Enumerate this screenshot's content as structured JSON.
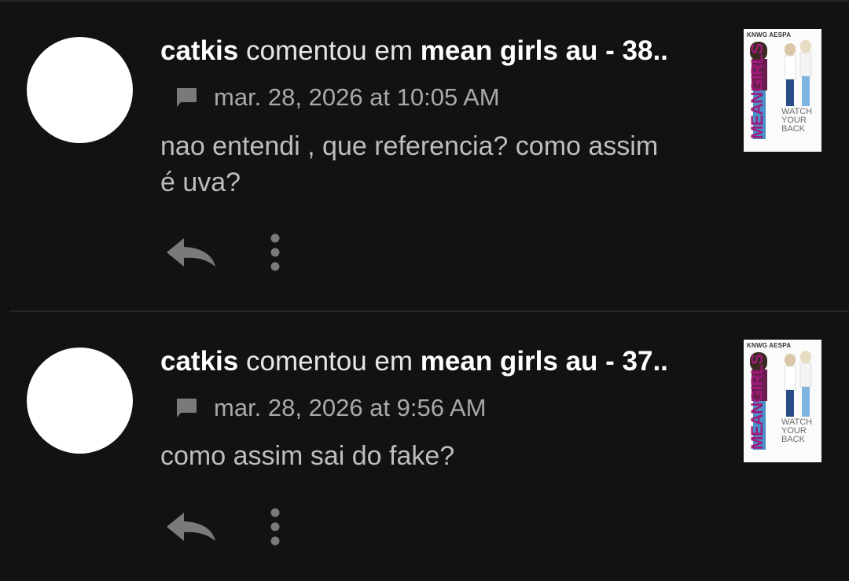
{
  "notifications": [
    {
      "user": "catkis",
      "verb": "comentou em",
      "target": "mean girls au - 38..",
      "timestamp": "mar. 28, 2026 at 10:05 AM",
      "body": "nao entendi , que referencia? como assim é uva?",
      "thumbnail": {
        "brand": "KNWG AESPA",
        "title": "MEANGIRLS",
        "tagline": "WATCH\nYOUR\nBACK"
      }
    },
    {
      "user": "catkis",
      "verb": "comentou em",
      "target": "mean girls au - 37..",
      "timestamp": "mar. 28, 2026 at 9:56 AM",
      "body": "como assim sai do fake?",
      "thumbnail": {
        "brand": "KNWG AESPA",
        "title": "MEANGIRLS",
        "tagline": "WATCH\nYOUR\nBACK"
      }
    }
  ],
  "icons": {
    "comment": "comment-icon",
    "reply": "reply-icon",
    "more": "more-vertical-icon"
  },
  "colors": {
    "background": "#121212",
    "icon": "#7a7a7a",
    "accent_title": "#a0197a"
  }
}
